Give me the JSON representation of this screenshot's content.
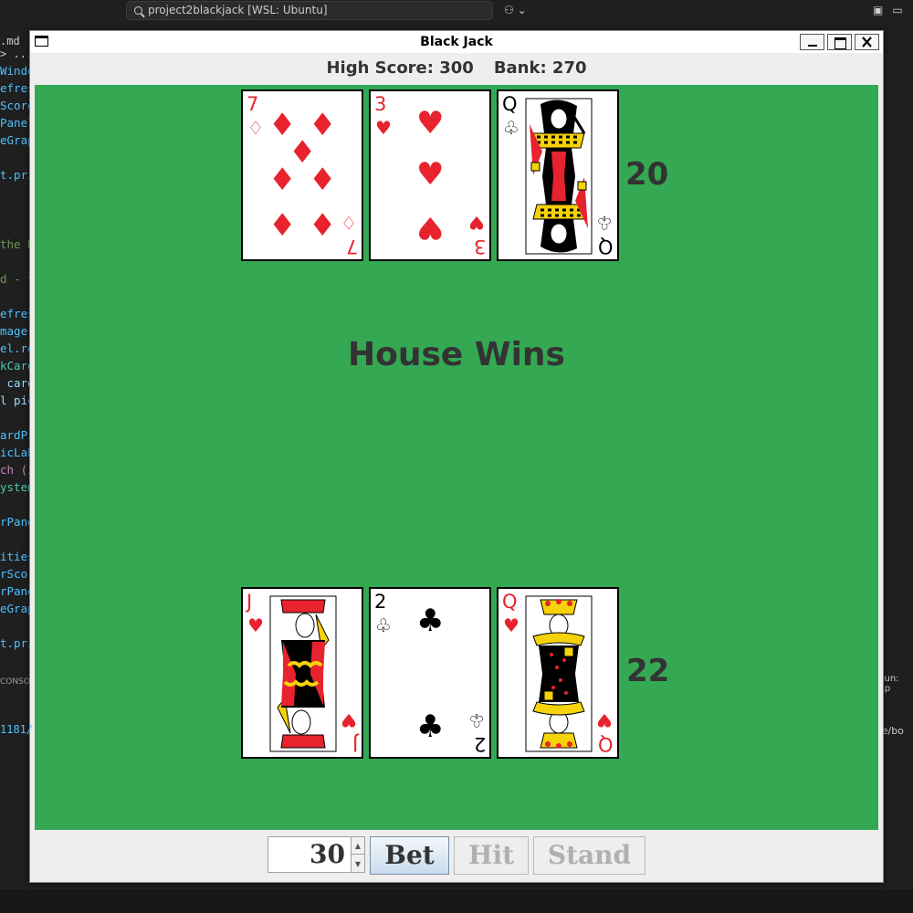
{
  "background": {
    "search_text": "project2blackjack [WSL: Ubuntu]",
    "file_tab": ".md",
    "breadcrumb": "> ...",
    "code_lines": [
      {
        "text": "Windo",
        "color": "#4fc1ff"
      },
      {
        "text": "efres",
        "color": "#4fc1ff"
      },
      {
        "text": "Score",
        "color": "#4fc1ff"
      },
      {
        "text": "Panel",
        "color": "#4fc1ff"
      },
      {
        "text": "eGrap",
        "color": "#4fc1ff"
      },
      {
        "text": "",
        "color": "#cccccc"
      },
      {
        "text": "t.pri",
        "color": "#4fc1ff"
      },
      {
        "text": "",
        "color": "#cccccc"
      },
      {
        "text": "",
        "color": "#cccccc"
      },
      {
        "text": "",
        "color": "#cccccc"
      },
      {
        "text": "the H",
        "color": "#6a9955"
      },
      {
        "text": "",
        "color": "#cccccc"
      },
      {
        "text": "d - t",
        "color": "#6a9955"
      },
      {
        "text": "",
        "color": "#cccccc"
      },
      {
        "text": "efres",
        "color": "#4fc1ff"
      },
      {
        "text": "mage",
        "color": "#4fc1ff"
      },
      {
        "text": "el.re",
        "color": "#4fc1ff"
      },
      {
        "text": "kCard",
        "color": "#4ec9b0"
      },
      {
        "text": " card",
        "color": "#9cdcfe"
      },
      {
        "text": "l pic",
        "color": "#9cdcfe"
      },
      {
        "text": "",
        "color": "#cccccc"
      },
      {
        "text": "ardPi",
        "color": "#4fc1ff"
      },
      {
        "text": "icLab",
        "color": "#4fc1ff"
      },
      {
        "text": "ch (i",
        "color": "#c586c0"
      },
      {
        "text": "ystem",
        "color": "#4ec9b0"
      },
      {
        "text": "",
        "color": "#cccccc"
      },
      {
        "text": "rPane",
        "color": "#4fc1ff"
      },
      {
        "text": "",
        "color": "#cccccc"
      },
      {
        "text": "ities",
        "color": "#4fc1ff"
      },
      {
        "text": "rScor",
        "color": "#4fc1ff"
      },
      {
        "text": "rPane",
        "color": "#4fc1ff"
      },
      {
        "text": "eGrap",
        "color": "#4fc1ff"
      },
      {
        "text": "",
        "color": "#cccccc"
      },
      {
        "text": "t.pri",
        "color": "#4fc1ff"
      }
    ],
    "console_label": "CONSO",
    "terminal_line": "1181/",
    "run_label": "Run: Ap",
    "right_path": "me/bo"
  },
  "window": {
    "title": "Black Jack"
  },
  "scores": {
    "high_score": "High Score: 300",
    "bank": "Bank: 270"
  },
  "dealer": {
    "total": "20",
    "cards": [
      {
        "rank": "7",
        "suit": "♦",
        "color": "red"
      },
      {
        "rank": "3",
        "suit": "♥",
        "color": "red"
      },
      {
        "rank": "Q",
        "suit": "♣",
        "color": "black"
      }
    ]
  },
  "player": {
    "total": "22",
    "cards": [
      {
        "rank": "J",
        "suit": "♥",
        "color": "red"
      },
      {
        "rank": "2",
        "suit": "♣",
        "color": "black"
      },
      {
        "rank": "Q",
        "suit": "♥",
        "color": "red"
      }
    ]
  },
  "result": "House Wins",
  "controls": {
    "bet_amount": "30",
    "bet_label": "Bet",
    "hit_label": "Hit",
    "stand_label": "Stand"
  }
}
